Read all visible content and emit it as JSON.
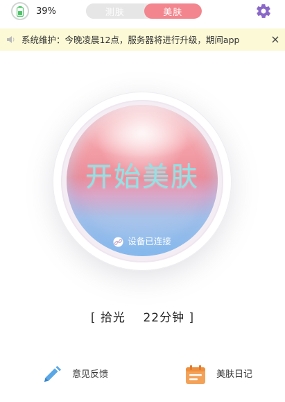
{
  "header": {
    "battery_percent": "39%",
    "tabs": [
      {
        "label": "测肤",
        "active": false
      },
      {
        "label": "美肤",
        "active": true
      }
    ],
    "colors": {
      "accent": "#f2858d",
      "inactive_tab": "#e6e6e6",
      "settings_icon": "#8a68c8"
    },
    "icons": {
      "battery": "battery-icon",
      "settings": "gear-icon"
    }
  },
  "notice": {
    "text": "系统维护：今晚凌晨12点，服务器将进行升级，期间app",
    "icons": {
      "speaker": "speaker-icon",
      "close": "close-icon"
    },
    "close_label": "×",
    "background": "#fbf9d6"
  },
  "orb": {
    "title": "开始美肤",
    "status": "设备已连接",
    "icons": {
      "status": "link-icon"
    }
  },
  "mode": {
    "open": "[",
    "name": "拾光",
    "duration": "22分钟",
    "close": "]"
  },
  "actions": [
    {
      "label": "意见反馈",
      "icon": "pencil-icon",
      "color": "#5aa7e6"
    },
    {
      "label": "美肤日记",
      "icon": "calendar-icon",
      "color": "#f3a25a"
    }
  ]
}
